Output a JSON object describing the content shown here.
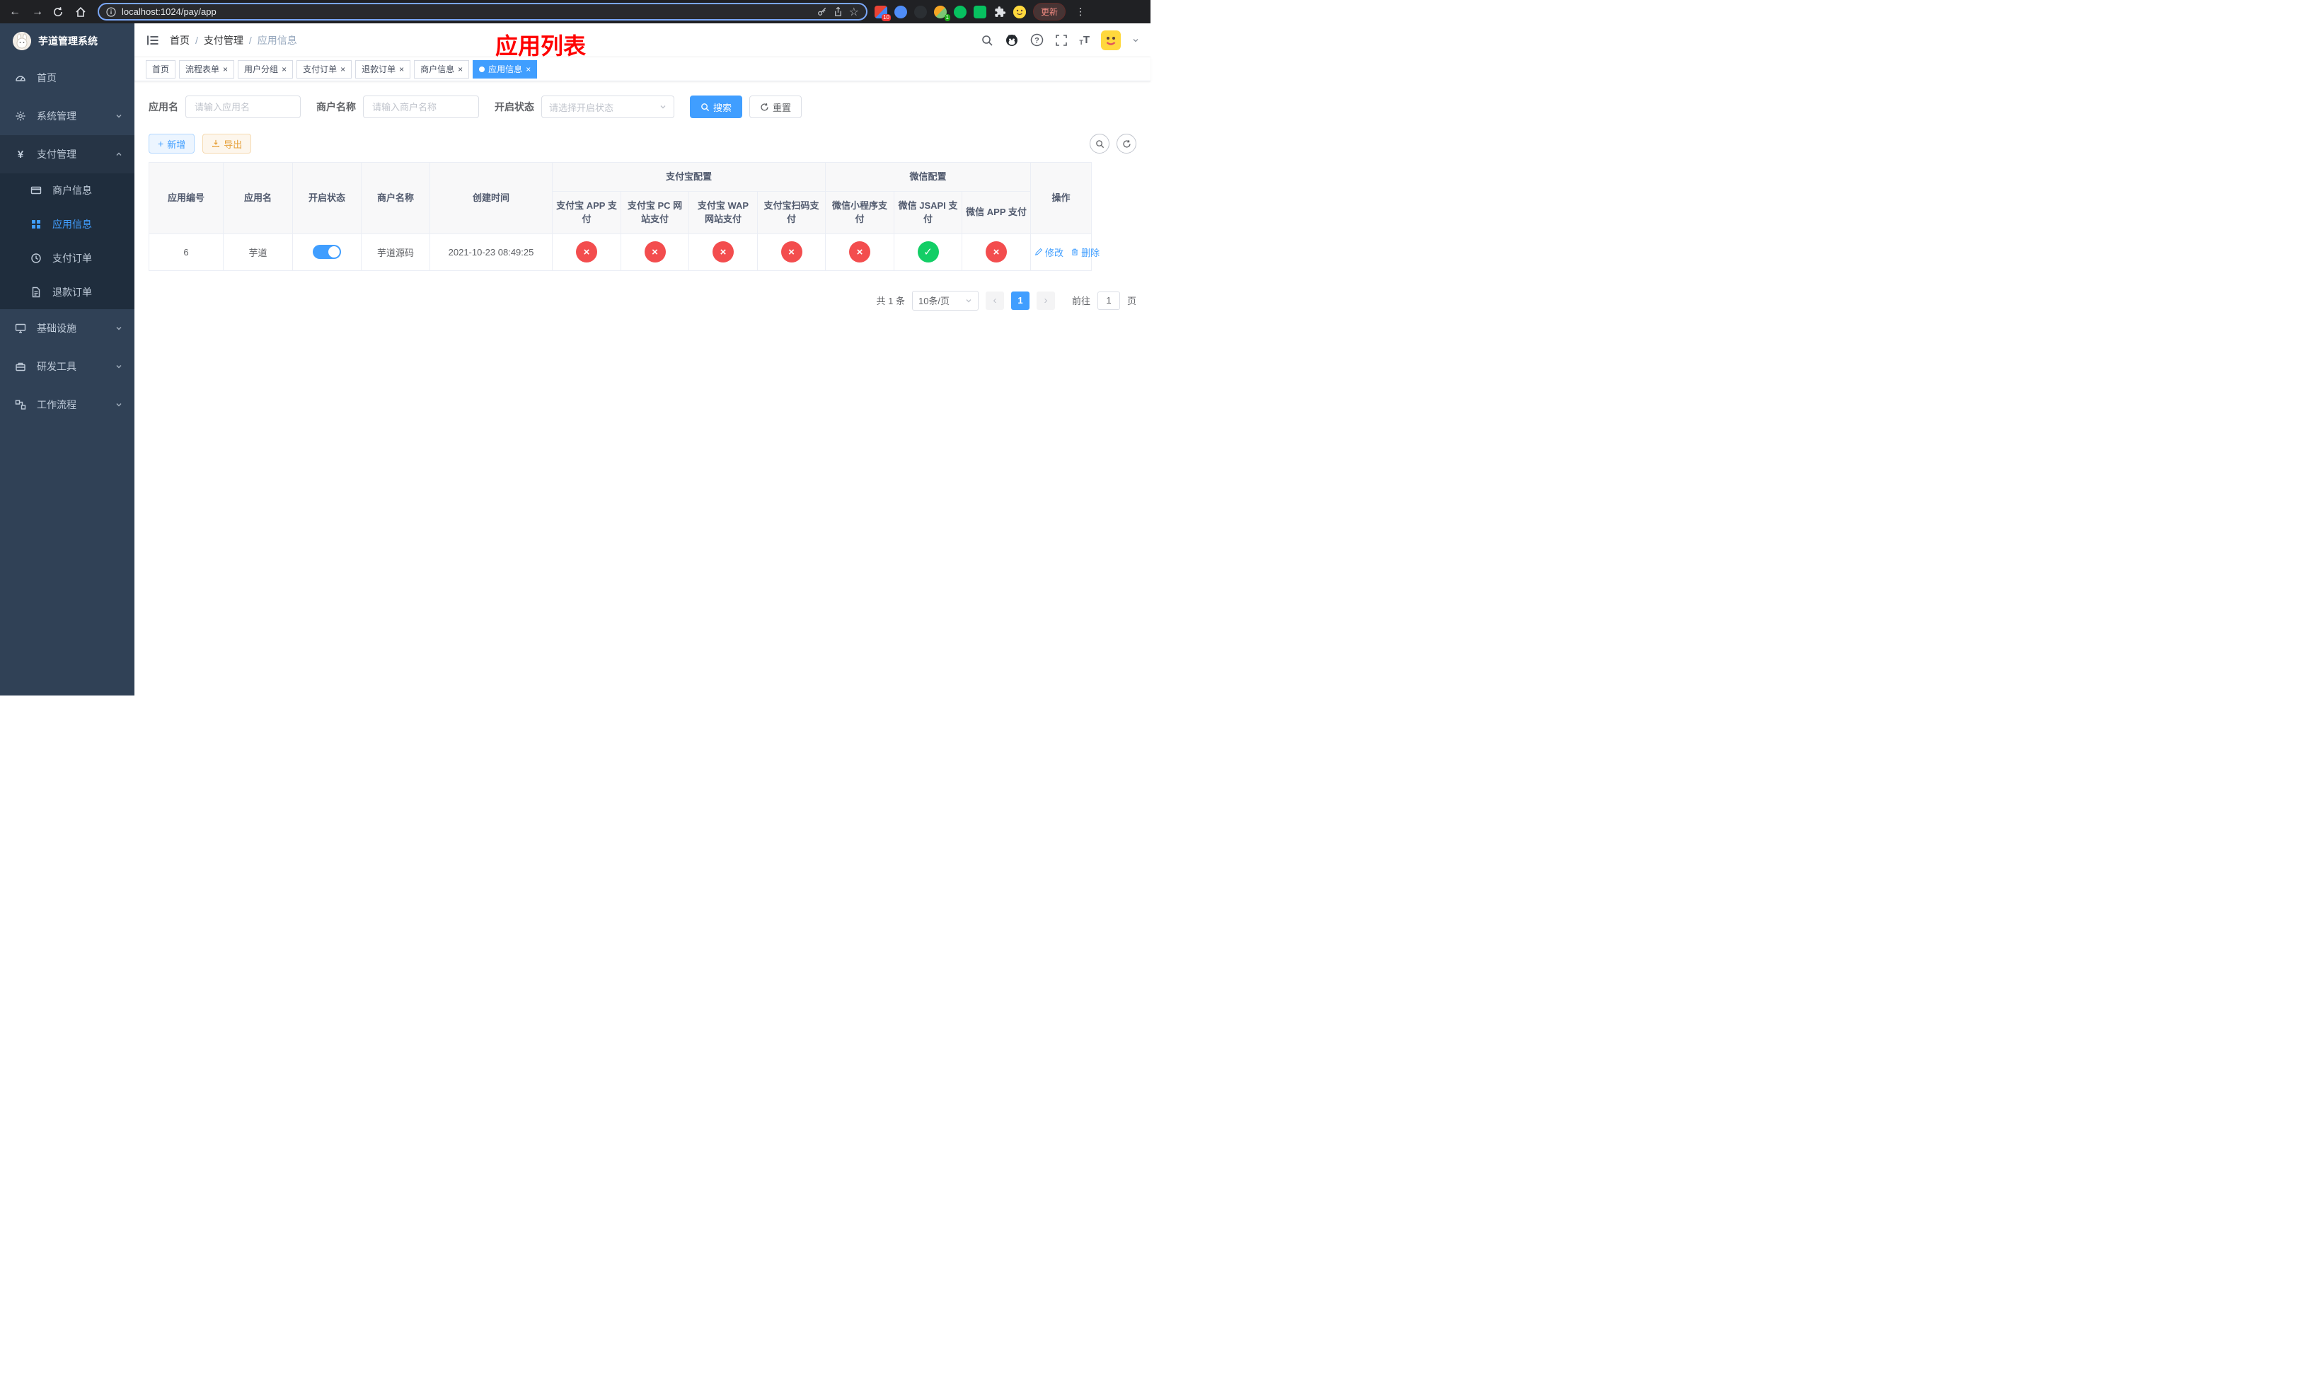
{
  "colors": {
    "primary": "#409eff",
    "danger": "#f34d4e",
    "success": "#13ce66"
  },
  "browser": {
    "url": "localhost:1024/pay/app",
    "update_label": "更新",
    "ext_badge_count": "10",
    "ext_avatar_badge": "1"
  },
  "sidebar": {
    "title": "芋道管理系统",
    "items": [
      {
        "label": "首页"
      },
      {
        "label": "系统管理"
      },
      {
        "label": "支付管理"
      },
      {
        "label": "商户信息"
      },
      {
        "label": "应用信息"
      },
      {
        "label": "支付订单"
      },
      {
        "label": "退款订单"
      },
      {
        "label": "基础设施"
      },
      {
        "label": "研发工具"
      },
      {
        "label": "工作流程"
      }
    ]
  },
  "header": {
    "breadcrumb": [
      "首页",
      "支付管理",
      "应用信息"
    ],
    "separator": "/",
    "annotation": "应用列表"
  },
  "tabs": [
    {
      "label": "首页"
    },
    {
      "label": "流程表单"
    },
    {
      "label": "用户分组"
    },
    {
      "label": "支付订单"
    },
    {
      "label": "退款订单"
    },
    {
      "label": "商户信息"
    },
    {
      "label": "应用信息"
    }
  ],
  "filters": {
    "app_name_label": "应用名",
    "app_name_placeholder": "请输入应用名",
    "merchant_label": "商户名称",
    "merchant_placeholder": "请输入商户名称",
    "status_label": "开启状态",
    "status_placeholder": "请选择开启状态",
    "search_label": "搜索",
    "reset_label": "重置"
  },
  "toolbar": {
    "add_label": "新增",
    "export_label": "导出"
  },
  "table": {
    "columns": {
      "id": "应用编号",
      "name": "应用名",
      "status": "开启状态",
      "merchant": "商户名称",
      "created": "创建时间",
      "op": "操作"
    },
    "groups": {
      "alipay": "支付宝配置",
      "wechat": "微信配置"
    },
    "alipay_cols": [
      "支付宝 APP 支付",
      "支付宝 PC 网站支付",
      "支付宝 WAP 网站支付",
      "支付宝扫码支付"
    ],
    "wechat_cols": [
      "微信小程序支付",
      "微信 JSAPI 支付",
      "微信 APP 支付"
    ],
    "row": {
      "id": "6",
      "name": "芋道",
      "enabled": true,
      "merchant": "芋道源码",
      "created": "2021-10-23 08:49:25",
      "statuses": [
        false,
        false,
        false,
        false,
        false,
        true,
        false
      ]
    },
    "actions": {
      "edit": "修改",
      "delete": "删除"
    }
  },
  "pagination": {
    "total_label": "共 1 条",
    "page_size_label": "10条/页",
    "page": "1",
    "goto_prefix": "前往",
    "goto_value": "1",
    "goto_suffix": "页"
  }
}
